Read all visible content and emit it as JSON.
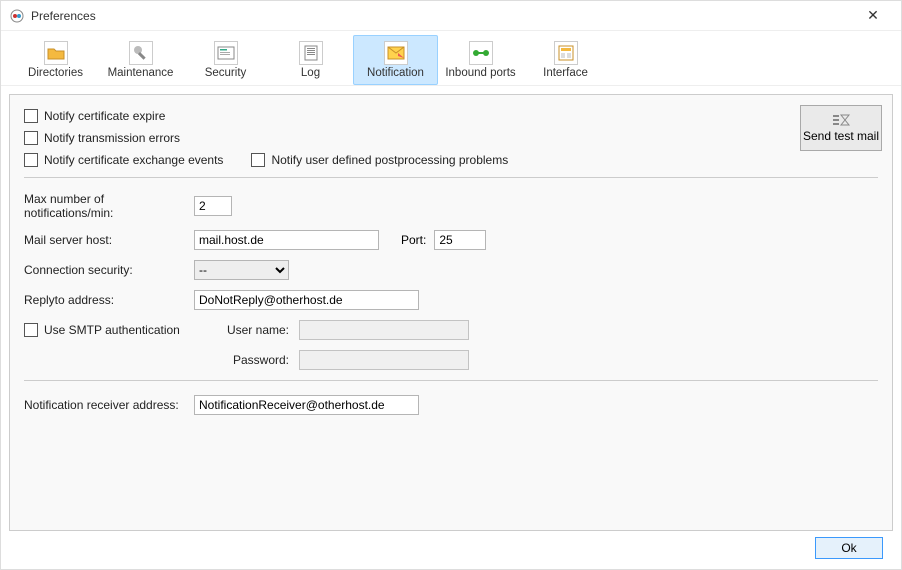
{
  "window": {
    "title": "Preferences",
    "close": "✕"
  },
  "tabs": {
    "directories": "Directories",
    "maintenance": "Maintenance",
    "security": "Security",
    "log": "Log",
    "notification": "Notification",
    "inbound": "Inbound ports",
    "interface": "Interface"
  },
  "checks": {
    "certExpire": "Notify certificate expire",
    "transErrors": "Notify transmission errors",
    "certExchange": "Notify certificate exchange events",
    "postProc": "Notify user defined postprocessing problems",
    "smtpAuth": "Use SMTP authentication"
  },
  "sendTest": "Send test mail",
  "labels": {
    "maxNotif": "Max number of notifications/min:",
    "mailHost": "Mail server host:",
    "port": "Port:",
    "connSec": "Connection security:",
    "replyTo": "Replyto address:",
    "userName": "User name:",
    "password": "Password:",
    "receiver": "Notification receiver address:"
  },
  "values": {
    "maxNotif": "2",
    "mailHost": "mail.host.de",
    "port": "25",
    "connSec": "--",
    "replyTo": "DoNotReply@otherhost.de",
    "userName": "",
    "password": "",
    "receiver": "NotificationReceiver@otherhost.de"
  },
  "ok": "Ok"
}
